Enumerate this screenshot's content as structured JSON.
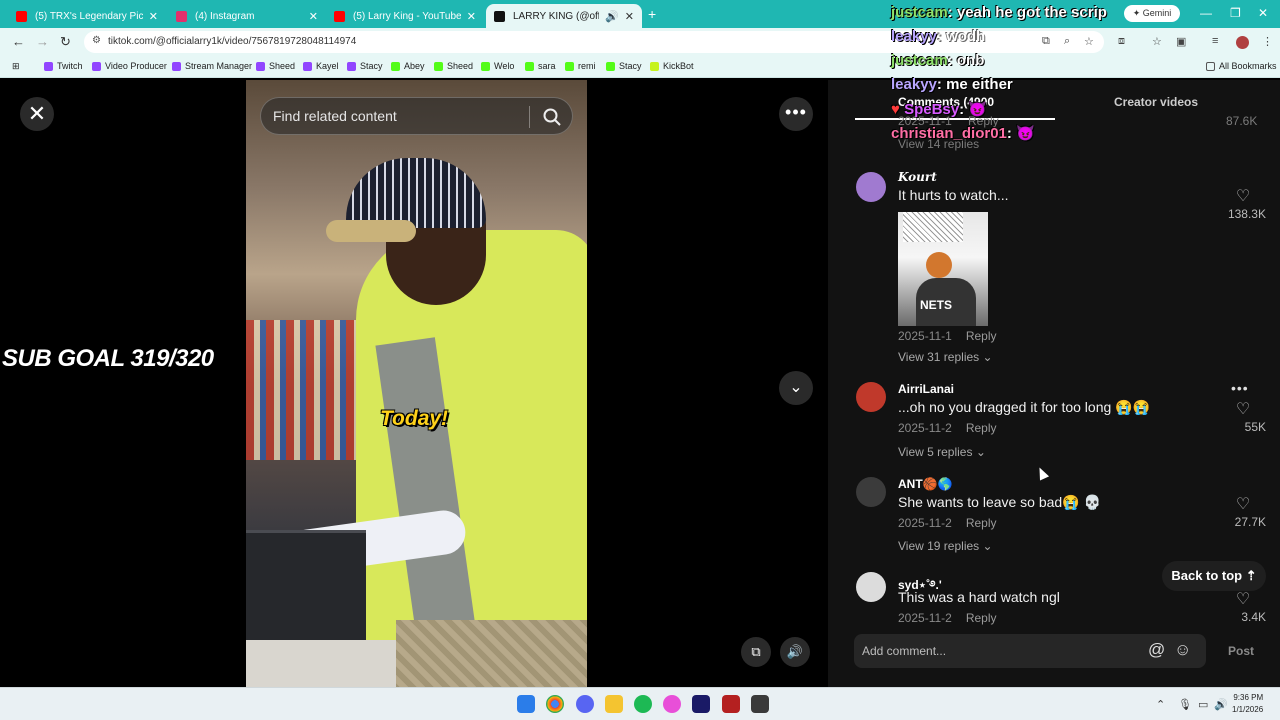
{
  "browser": {
    "tabs": [
      {
        "title": "(5) TRX's Legendary Pickup Tru",
        "favicon_color": "#ff0000"
      },
      {
        "title": "(4) Instagram",
        "favicon_color": "#e1306c"
      },
      {
        "title": "(5) Larry King - YouTube",
        "favicon_color": "#ff0000"
      },
      {
        "title": "LARRY KING (@officialarry1",
        "favicon_color": "#111111"
      }
    ],
    "url": "tiktok.com/@officialarry1k/video/7567819728048114974",
    "bookmarks": [
      "Twitch",
      "Video Producer",
      "Stream Manager",
      "Sheed",
      "Kayel",
      "Stacy",
      "Abey",
      "Sheed",
      "Welo",
      "sara",
      "remi",
      "Stacy",
      "KickBot"
    ],
    "all_bookmarks": "All Bookmarks",
    "gemini": "Gemini"
  },
  "video": {
    "search_placeholder": "Find related content",
    "caption": "Today!",
    "overlay_goal": "SUB GOAL 319/320"
  },
  "panel": {
    "tab_comments": "Comments (4900",
    "tab_creator": "Creator videos",
    "faded_top_date": "2025-11-1",
    "faded_top_reply": "Reply",
    "faded_top_count": "87.6K",
    "faded_top_replies": "View 14 replies"
  },
  "comments": [
    {
      "user": "Kourt",
      "text": "It hurts to watch...",
      "image_label": "NETS",
      "date": "2025-11-1",
      "reply": "Reply",
      "likes": "138.3K",
      "replies": "View 31 replies",
      "avatar_color": "#a07ad0"
    },
    {
      "user": "AirriLanai",
      "text": "...oh no you dragged it for too long 😭😭",
      "date": "2025-11-2",
      "reply": "Reply",
      "likes": "55K",
      "replies": "View 5 replies",
      "avatar_color": "#c0392b"
    },
    {
      "user": "ANT🏀🌎",
      "text": "She wants to leave so bad😭 💀",
      "date": "2025-11-2",
      "reply": "Reply",
      "likes": "27.7K",
      "replies": "View 19 replies",
      "avatar_color": "#3b3b3b"
    },
    {
      "user": "syd⋆˚࿔.'",
      "text": "This was a hard watch ngl",
      "date": "2025-11-2",
      "reply": "Reply",
      "likes": "3.4K",
      "replies": "",
      "avatar_color": "#dcdcdc"
    }
  ],
  "back_to_top": "Back to top",
  "add_comment_placeholder": "Add comment...",
  "post_label": "Post",
  "chat": [
    {
      "user": "justcam",
      "message": "yeah he got the scrip",
      "color": "#8fe36b"
    },
    {
      "user": "leakyy",
      "message": "wodh",
      "color": "#b9a6ff"
    },
    {
      "user": "justcam",
      "message": "onb",
      "color": "#8fe36b"
    },
    {
      "user": "leakyy",
      "message": "me either",
      "color": "#b9a6ff"
    },
    {
      "user": "SpeBsy",
      "message": "",
      "color": "#d85bff"
    },
    {
      "user": "christian_dior01",
      "message": "",
      "color": "#ff6fa6"
    }
  ],
  "taskbar": {
    "time": "9:36 PM",
    "date": "1/1/2026"
  }
}
